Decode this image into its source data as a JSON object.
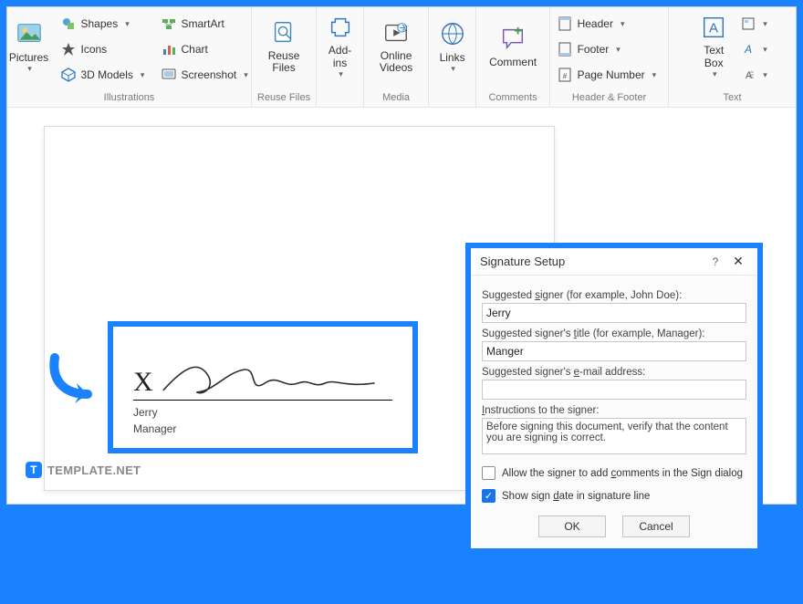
{
  "ribbon": {
    "groups": {
      "illustrations": {
        "label": "Illustrations",
        "pictures": "Pictures",
        "shapes": "Shapes",
        "icons": "Icons",
        "models": "3D Models",
        "smartart": "SmartArt",
        "chart": "Chart",
        "screenshot": "Screenshot"
      },
      "reuse": {
        "label": "Reuse Files",
        "btn": "Reuse\nFiles"
      },
      "addins": {
        "label": "",
        "btn": "Add-\nins"
      },
      "media": {
        "label": "Media",
        "btn": "Online\nVideos"
      },
      "links": {
        "label": "",
        "btn": "Links"
      },
      "comments": {
        "label": "Comments",
        "btn": "Comment"
      },
      "hf": {
        "label": "Header & Footer",
        "header": "Header",
        "footer": "Footer",
        "pagenum": "Page Number"
      },
      "text": {
        "label": "Text",
        "textbox": "Text\nBox"
      }
    }
  },
  "signature_block": {
    "x_label": "X",
    "name": "Jerry",
    "title": "Manager"
  },
  "dialog": {
    "title": "Signature Setup",
    "help": "?",
    "close": "✕",
    "lbl_signer": "Suggested signer (for example, John Doe):",
    "val_signer": "Jerry",
    "lbl_title": "Suggested signer's title (for example, Manager):",
    "val_title": "Manger",
    "lbl_email": "Suggested signer's e-mail address:",
    "val_email": "",
    "lbl_instr": "Instructions to the signer:",
    "val_instr": "Before signing this document, verify that the content you are signing is correct.",
    "chk_comments": "Allow the signer to add comments in the Sign dialog",
    "chk_date": "Show sign date in signature line",
    "ok": "OK",
    "cancel": "Cancel"
  },
  "watermark": {
    "text": "TEMPLATE.NET"
  }
}
